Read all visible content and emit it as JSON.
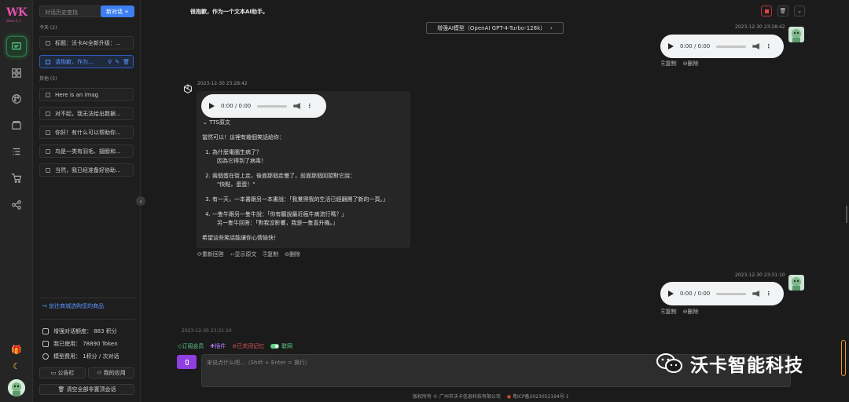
{
  "brand": {
    "logo": "WK",
    "version": "Woka 4.1"
  },
  "sidebar": {
    "search_placeholder": "对话历史查找",
    "new_chat": "新对话 +",
    "groups": [
      {
        "label": "今天 (2)"
      },
      {
        "label": "其他 (5)"
      }
    ],
    "today": [
      {
        "title": "标题：沃卡AI全新升级：..."
      },
      {
        "title": "请抱歉，作为..."
      }
    ],
    "other": [
      {
        "title": "Here is an imag"
      },
      {
        "title": "对不起，我无法给出数据..."
      },
      {
        "title": "你好！有什么可以帮助你..."
      },
      {
        "title": "鸟是一类有羽毛、翅膀和..."
      },
      {
        "title": "当然，我已经准备好协助..."
      }
    ],
    "store_link": "前往商城选购您的商品",
    "stats": {
      "dialog_quota": "增强对话额度：  883 积分",
      "used": "我已使用：  78890 Token",
      "model_cost": "模型费用：  1积分 / 次对话"
    },
    "buttons": {
      "notice": "公告栏",
      "apps": "我的应用",
      "clear": "清空全部非置顶会话"
    }
  },
  "main": {
    "title": "很抱歉，作为一个文本AI助手。",
    "model": "增强AI模型（OpenAI GPT-4-Turbo-128k）",
    "messages": [
      {
        "ts": "2023-12-30 23:28:42",
        "audio_time": "0:00 / 0:00",
        "actions": [
          "复制",
          "删除"
        ]
      },
      {
        "ts": "2023-12-30 23:28:42",
        "audio_time": "0:00 / 0:00",
        "tts_label": "TTS原文",
        "intro": "當然可以！這裡有幾個笑話給你：",
        "items": [
          {
            "line1": "為什麼電腦生病了？",
            "line2": "因為它得到了病毒！"
          },
          {
            "line1": "兩個蛋在街上走，後面那個走慢了，前面那個回頭對它說：",
            "line2": "\"快點，蛋蛋！\""
          },
          {
            "line1": "有一天，一本書跟另一本書說：「我覺得我的生活已經翻開了新的一頁。」",
            "line2": ""
          },
          {
            "line1": "一隻牛跟另一隻牛說：「你有聽說最近瘋牛病流行嗎？」",
            "line2": "另一隻牛回答：「對我沒影響，我是一隻直升機。」"
          }
        ],
        "outro": "希望這些笑話能讓你心情愉快！",
        "actions": [
          "重新回答",
          "显示原文",
          "复制",
          "删除"
        ]
      },
      {
        "ts": "2023-12-30 23:31:10",
        "audio_time": "0:00 / 0:00",
        "actions": [
          "复制",
          "删除"
        ]
      },
      {
        "ts": "2023-12-30 23:31:10"
      }
    ],
    "toolbar": {
      "subscribe": "订阅会员",
      "plugin": "插件",
      "memory": "已关闭记忆",
      "network": "联网"
    },
    "input_placeholder": "来说点什么吧...（Shift + Enter = 换行）",
    "footer": {
      "copyright": "版权所有 © 广州市沃卡信息科技有限公司",
      "icp": "粤ICP备2023052194号-1"
    },
    "watermark": "沃卡智能科技"
  },
  "colors": {
    "accent": "#3d7ef0",
    "green": "#5fd38a",
    "purple": "#8f3ee0",
    "brand": "#e24fb0"
  }
}
